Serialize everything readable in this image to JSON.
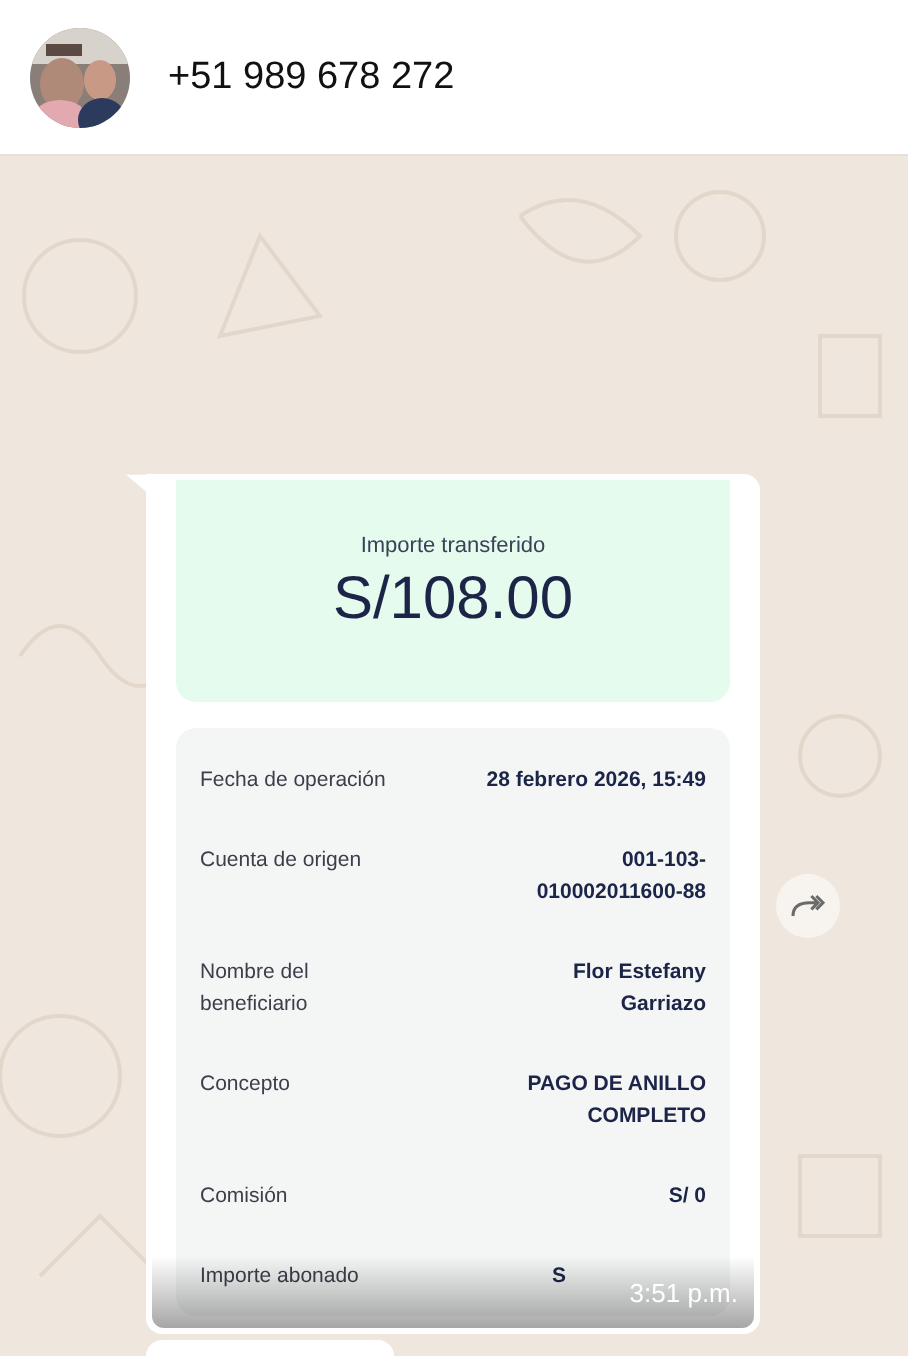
{
  "contact": {
    "phone": "+51 989 678 272"
  },
  "message": {
    "receipt": {
      "amount_label": "Importe transferido",
      "amount": "S/108.00",
      "details": [
        {
          "label": "Fecha de operación",
          "value": "28 febrero 2026, 15:49"
        },
        {
          "label": "Cuenta de origen",
          "value": "001-103-\n010002011600-88"
        },
        {
          "label": "Nombre del\nbeneficiario",
          "value": "Flor Estefany\nGarriazo"
        },
        {
          "label": "Concepto",
          "value": "PAGO DE ANILLO\nCOMPLETO"
        },
        {
          "label": "Comisión",
          "value": "S/ 0"
        },
        {
          "label": "Importe abonado",
          "value": "S"
        }
      ]
    },
    "time": "3:51 p.m."
  }
}
